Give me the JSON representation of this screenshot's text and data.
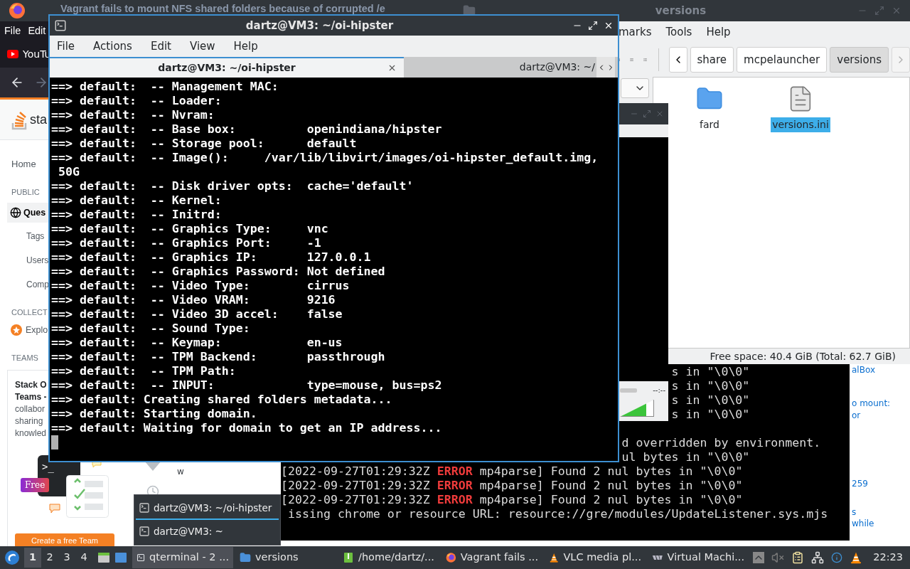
{
  "firefox": {
    "title": "Vagrant fails to mount NFS shared folders because of corrupted /e",
    "menu": [
      "File",
      "Edit"
    ],
    "bookmark": "YouTu",
    "sidebar": [
      {
        "kind": "link",
        "label": "Home",
        "selected": false
      },
      {
        "kind": "heading",
        "label": "PUBLIC"
      },
      {
        "kind": "questions",
        "label": "Ques",
        "selected": true
      },
      {
        "kind": "sub",
        "label": "Tags",
        "selected": false
      },
      {
        "kind": "sub",
        "label": "Users",
        "selected": false
      },
      {
        "kind": "sub",
        "label": "Comp",
        "selected": false
      },
      {
        "kind": "heading",
        "label": "COLLECT"
      },
      {
        "kind": "collectives",
        "label": "Explo",
        "selected": false
      },
      {
        "kind": "heading",
        "label": "TEAMS"
      }
    ],
    "logo_text": "sta",
    "teams_card": {
      "title_lines": [
        "Stack O",
        "Teams -"
      ],
      "body_lines": [
        "collabor",
        "sharing",
        "knowled"
      ],
      "prompt": ">_",
      "badge": "Free",
      "button": "Create a free Team"
    },
    "content_fragment": "w",
    "right_fragments": [
      "alBox",
      "o mount:",
      "or",
      "259",
      "s",
      "while"
    ]
  },
  "log_terminal": {
    "lines": [
      {
        "kind": "plain",
        "text": "s in \"\\0\\0\""
      },
      {
        "kind": "plain",
        "text": "s in \"\\0\\0\""
      },
      {
        "kind": "plain",
        "text": "s in \"\\0\\0\""
      },
      {
        "kind": "plain",
        "text": "s in \"\\0\\0\""
      },
      {
        "kind": "plain",
        "text": "d overridden by environment."
      },
      {
        "kind": "plain",
        "text": "ul bytes in \"\\0\\0\""
      },
      {
        "kind": "error",
        "prefix": "[2022-09-27T01:29:32Z",
        "level": "ERROR",
        "text": "mp4parse] Found 2 nul bytes in \"\\0\\0\""
      },
      {
        "kind": "error",
        "prefix": "[2022-09-27T01:29:32Z",
        "level": "ERROR",
        "text": "mp4parse] Found 2 nul bytes in \"\\0\\0\""
      },
      {
        "kind": "error",
        "prefix": "[2022-09-27T01:29:32Z",
        "level": "ERROR",
        "text": "mp4parse] Found 2 nul bytes in \"\\0\\0\""
      },
      {
        "kind": "plain",
        "text": "issing chrome or resource URL: resource://gre/modules/UpdateListener.sys.mjs"
      }
    ]
  },
  "file_manager": {
    "title": "versions",
    "menu": [
      "marks",
      "Tools",
      "Help"
    ],
    "breadcrumbs": [
      {
        "label": "share",
        "selected": false
      },
      {
        "label": "mcpelauncher",
        "selected": false
      },
      {
        "label": "versions",
        "selected": true
      }
    ],
    "files": [
      {
        "name": "fard",
        "kind": "folder",
        "selected": false
      },
      {
        "name": "versions.ini",
        "kind": "file",
        "selected": true
      }
    ],
    "status": "Free space: 40.4 GiB (Total: 62.7 GiB)"
  },
  "vlc": {
    "time": "--:--",
    "volume": {
      "level": 0.78
    }
  },
  "terminal": {
    "title": "dartz@VM3: ~/oi-hipster",
    "menu": [
      "File",
      "Actions",
      "Edit",
      "View",
      "Help"
    ],
    "tabs": [
      {
        "label": "dartz@VM3: ~/oi-hipster",
        "selected": true
      },
      {
        "label": "dartz@VM3: ~/",
        "selected": false
      }
    ],
    "lines": [
      "==> default:  -- Management MAC:",
      "==> default:  -- Loader:",
      "==> default:  -- Nvram:",
      "==> default:  -- Base box:          openindiana/hipster",
      "==> default:  -- Storage pool:      default",
      "==> default:  -- Image():     /var/lib/libvirt/images/oi-hipster_default.img,",
      " 50G",
      "==> default:  -- Disk driver opts:  cache='default'",
      "==> default:  -- Kernel:",
      "==> default:  -- Initrd:",
      "==> default:  -- Graphics Type:     vnc",
      "==> default:  -- Graphics Port:     -1",
      "==> default:  -- Graphics IP:       127.0.0.1",
      "==> default:  -- Graphics Password: Not defined",
      "==> default:  -- Video Type:        cirrus",
      "==> default:  -- Video VRAM:        9216",
      "==> default:  -- Video 3D accel:    false",
      "==> default:  -- Sound Type:",
      "==> default:  -- Keymap:            en-us",
      "==> default:  -- TPM Backend:       passthrough",
      "==> default:  -- TPM Path:",
      "==> default:  -- INPUT:             type=mouse, bus=ps2",
      "==> default: Creating shared folders metadata...",
      "==> default: Starting domain.",
      "==> default: Waiting for domain to get an IP address..."
    ]
  },
  "window_list": [
    {
      "label": "dartz@VM3: ~/oi-hipster",
      "selected": true
    },
    {
      "label": "dartz@VM3: ~",
      "selected": false
    }
  ],
  "taskbar": {
    "workspaces": [
      {
        "label": "1",
        "selected": true
      },
      {
        "label": "2",
        "selected": false
      },
      {
        "label": "3",
        "selected": false
      },
      {
        "label": "4",
        "selected": false
      }
    ],
    "tasks": [
      {
        "kind": "terminal",
        "label": "qterminal - 2 ...",
        "selected": true
      },
      {
        "kind": "folder",
        "label": "versions",
        "selected": false
      },
      {
        "kind": "archive",
        "label": "/home/dartz/...",
        "selected": false
      },
      {
        "kind": "firefox",
        "label": "Vagrant fails ...",
        "selected": false
      },
      {
        "kind": "vlc",
        "label": "VLC media pl...",
        "selected": false
      },
      {
        "kind": "vbox",
        "label": "Virtual Machi...",
        "selected": false
      }
    ],
    "clock": "22:23"
  }
}
